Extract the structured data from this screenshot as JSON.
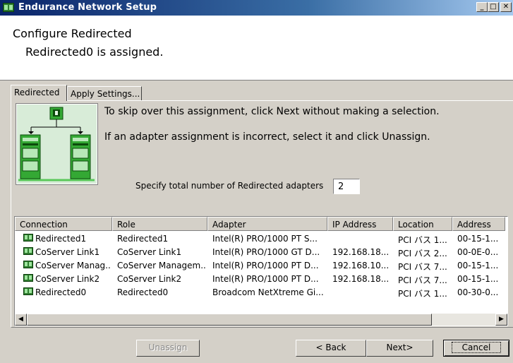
{
  "window": {
    "title": "Endurance Network Setup",
    "minimize_label": "_",
    "maximize_label": "□",
    "close_label": "✕"
  },
  "header": {
    "title": "Configure Redirected",
    "subtitle": "Redirected0 is assigned."
  },
  "tabs": [
    {
      "label": "Redirected",
      "active": true
    },
    {
      "label": "Apply Settings...",
      "active": false
    }
  ],
  "instructions": {
    "line1": "To skip over this assignment, click Next without making a selection.",
    "line2": "If an adapter assignment is incorrect, select it and click Unassign."
  },
  "adapter_count": {
    "label": "Specify total number of Redirected adapters",
    "value": "2"
  },
  "table": {
    "columns": [
      "Connection",
      "Role",
      "Adapter",
      "IP Address",
      "Location",
      "Address"
    ],
    "rows": [
      [
        "Redirected1",
        "Redirected1",
        "Intel(R) PRO/1000 PT S...",
        "",
        "PCI バス 1...",
        "00-15-1..."
      ],
      [
        "CoServer Link1",
        "CoServer Link1",
        "Intel(R) PRO/1000 GT D...",
        "192.168.18...",
        "PCI バス 2...",
        "00-0E-0..."
      ],
      [
        "CoServer Manag...",
        "CoServer Managem...",
        "Intel(R) PRO/1000 PT D...",
        "192.168.10...",
        "PCI バス 7...",
        "00-15-1..."
      ],
      [
        "CoServer Link2",
        "CoServer Link2",
        "Intel(R) PRO/1000 PT D...",
        "192.168.18...",
        "PCI バス 7...",
        "00-15-1..."
      ],
      [
        "Redirected0",
        "Redirected0",
        "Broadcom NetXtreme Gi...",
        "",
        "PCI バス 1...",
        "00-30-0..."
      ]
    ]
  },
  "scrollbar": {
    "left_arrow": "◀",
    "right_arrow": "▶"
  },
  "buttons": {
    "unassign": "Unassign",
    "back": "< Back",
    "next": "Next>",
    "cancel": "Cancel"
  },
  "colors": {
    "titlebar_start": "#0a246a",
    "titlebar_end": "#a6caf0",
    "face": "#d4d0c8",
    "network_icon": "#2f7d2f"
  }
}
